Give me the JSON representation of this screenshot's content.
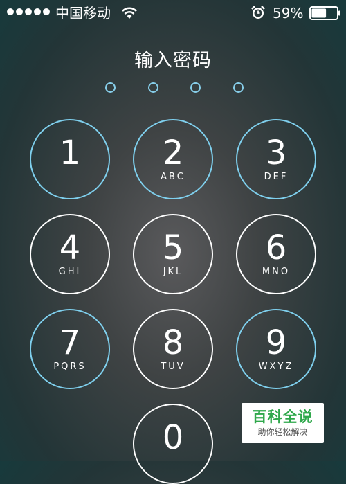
{
  "status_bar": {
    "carrier": "中国移动",
    "battery_percent": "59%",
    "battery_level": 0.59,
    "signal_bars": 5,
    "icons": [
      "signal-dots",
      "wifi-icon",
      "alarm-icon",
      "battery-icon"
    ]
  },
  "lock_screen": {
    "title": "输入密码",
    "passcode_length": 4,
    "keys": [
      {
        "digit": "1",
        "letters": ""
      },
      {
        "digit": "2",
        "letters": "ABC"
      },
      {
        "digit": "3",
        "letters": "DEF"
      },
      {
        "digit": "4",
        "letters": "GHI"
      },
      {
        "digit": "5",
        "letters": "JKL"
      },
      {
        "digit": "6",
        "letters": "MNO"
      },
      {
        "digit": "7",
        "letters": "PQRS"
      },
      {
        "digit": "8",
        "letters": "TUV"
      },
      {
        "digit": "9",
        "letters": "WXYZ"
      },
      {
        "digit": "0",
        "letters": ""
      }
    ]
  },
  "watermark": {
    "title": "百科全说",
    "subtitle": "助你轻松解决"
  },
  "colors": {
    "ring_blue": "#7fd0ee",
    "ring_white": "#ffffff",
    "watermark_green": "#2fa84b"
  }
}
